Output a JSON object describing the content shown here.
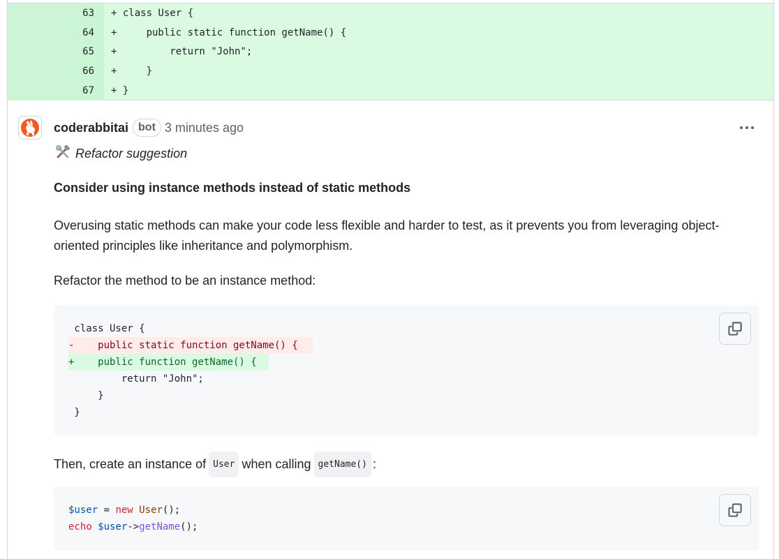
{
  "diff": {
    "rows": [
      {
        "line": "63",
        "code": "+ class User {"
      },
      {
        "line": "64",
        "code": "+     public static function getName() {"
      },
      {
        "line": "65",
        "code": "+         return \"John\";"
      },
      {
        "line": "66",
        "code": "+     }"
      },
      {
        "line": "67",
        "code": "+ }"
      }
    ]
  },
  "comment": {
    "author": "coderabbitai",
    "badge": "bot",
    "timestamp": "3 minutes ago",
    "more_icon": "kebab-horizontal-icon",
    "tag_icon": "hammer-wrench-icon",
    "tag": "Refactor suggestion",
    "heading": "Consider using instance methods instead of static methods",
    "paragraph1": "Overusing static methods can make your code less flexible and harder to test, as it prevents you from leveraging object-oriented principles like inheritance and polymorphism.",
    "paragraph2": "Refactor the method to be an instance method:",
    "code1": {
      "lines": [
        {
          "type": "plain",
          "text": " class User {"
        },
        {
          "type": "del",
          "text": "-    public static function getName() {"
        },
        {
          "type": "add",
          "text": "+    public function getName() {"
        },
        {
          "type": "plain",
          "text": "         return \"John\";"
        },
        {
          "type": "plain",
          "text": "     }"
        },
        {
          "type": "plain",
          "text": " }"
        }
      ],
      "copy_icon": "copy-icon"
    },
    "paragraph3_before": "Then, create an instance of",
    "inline1": "User",
    "paragraph3_middle": "when calling",
    "inline2": "getName()",
    "paragraph3_after": ":",
    "code2": {
      "line1": {
        "var": "$user",
        "op": " = ",
        "kw": "new",
        "cls": " User",
        "end": "();"
      },
      "line2": {
        "kw": "echo",
        "var": " $user",
        "arrow": "->",
        "fn": "getName",
        "end": "();"
      },
      "copy_icon": "copy-icon"
    }
  }
}
